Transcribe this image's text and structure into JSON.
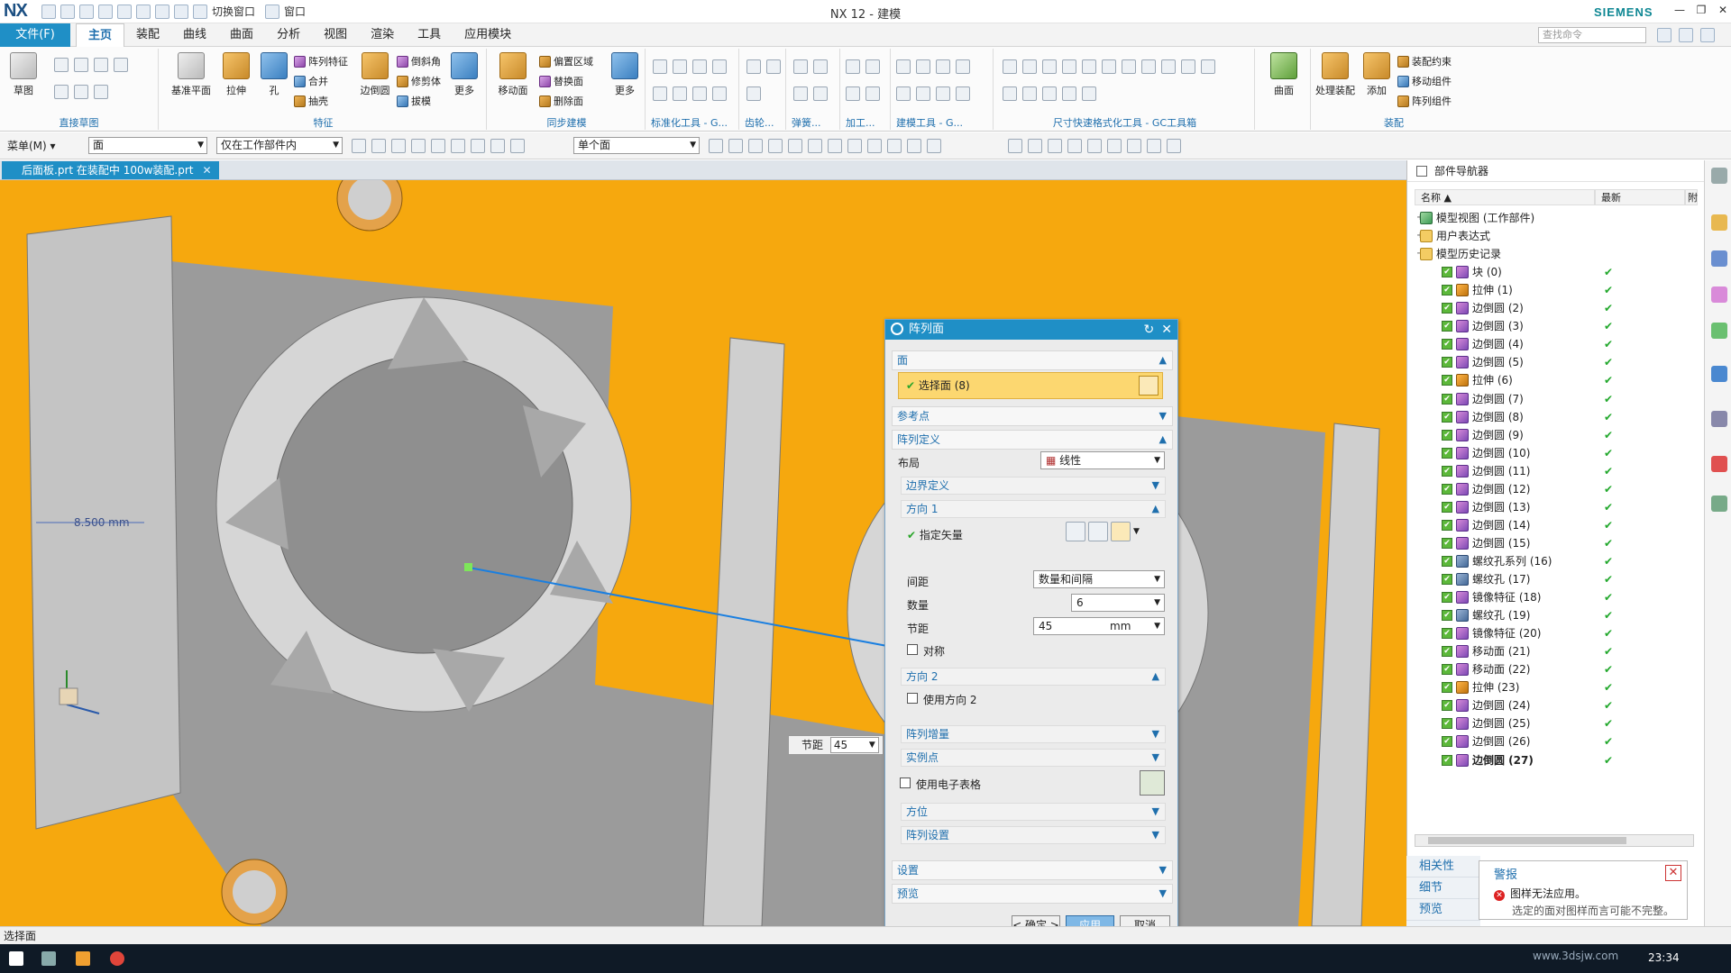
{
  "titlebar": {
    "logo": "NX",
    "title": "NX 12 - 建模",
    "brand": "SIEMENS",
    "switch_window": "切换窗口",
    "window": "窗口"
  },
  "menubar": {
    "file": "文件(F)",
    "tabs": [
      "主页",
      "装配",
      "曲线",
      "曲面",
      "分析",
      "视图",
      "渲染",
      "工具",
      "应用模块"
    ],
    "search_placeholder": "查找命令"
  },
  "ribbon": {
    "groups": {
      "direct_sketch": "直接草图",
      "feature": "特征",
      "sync": "同步建模",
      "std_tools": "标准化工具 - G...",
      "gear": "齿轮...",
      "spring": "弹簧...",
      "machining": "加工...",
      "build_tools": "建模工具 - G...",
      "dim_tools": "尺寸快速格式化工具 - GC工具箱",
      "assembly": "装配"
    },
    "buttons": {
      "sketch": "草图",
      "datum_plane": "基准平面",
      "extrude": "拉伸",
      "hole": "孔",
      "pattern_feature": "阵列特征",
      "unite": "合并",
      "shell": "抽壳",
      "edge_blend": "边倒圆",
      "chamfer": "倒斜角",
      "trim_body": "修剪体",
      "draft": "拔模",
      "more1": "更多",
      "move_face": "移动面",
      "offset_region": "偏置区域",
      "replace_face": "替换面",
      "delete_face": "删除面",
      "more2": "更多",
      "surface": "曲面",
      "process_assembly": "处理装配",
      "add": "添加",
      "assembly_constraint": "装配约束",
      "move_component": "移动组件",
      "pattern_component": "阵列组件"
    }
  },
  "toolbar2": {
    "menu": "菜单(M)",
    "filter": "面",
    "scope": "仅在工作部件内",
    "select_mode": "单个面"
  },
  "doctab": {
    "label": "后面板.prt 在装配中 100w装配.prt"
  },
  "viewport": {
    "dimension": "8.500 mm",
    "pitch_label": "节距",
    "pitch_value": "45"
  },
  "dialog": {
    "title": "阵列面",
    "face_section": "面",
    "select_face": "选择面 (8)",
    "ref_point": "参考点",
    "pattern_def": "阵列定义",
    "layout_label": "布局",
    "layout_value": "线性",
    "boundary": "边界定义",
    "dir1": "方向 1",
    "specify_vector": "指定矢量",
    "spacing_label": "间距",
    "spacing_value": "数量和间隔",
    "count_label": "数量",
    "count_value": "6",
    "pitch_label": "节距",
    "pitch_value": "45",
    "pitch_unit": "mm",
    "symmetric": "对称",
    "dir2": "方向 2",
    "use_dir2": "使用方向 2",
    "increment": "阵列增量",
    "instance_point": "实例点",
    "use_spreadsheet": "使用电子表格",
    "orientation": "方位",
    "pattern_settings": "阵列设置",
    "settings": "设置",
    "preview": "预览",
    "ok": "< 确定 >",
    "apply": "应用",
    "cancel": "取消"
  },
  "navigator": {
    "title": "部件导航器",
    "col_name": "名称",
    "col_latest": "最新",
    "col_extra": "附",
    "rows": [
      {
        "label": "模型视图 (工作部件)",
        "type": "model",
        "level": 0,
        "check": false
      },
      {
        "label": "用户表达式",
        "type": "folder",
        "level": 0,
        "check": false
      },
      {
        "label": "模型历史记录",
        "type": "folder",
        "level": 0,
        "check": false
      },
      {
        "label": "块 (0)",
        "type": "feat",
        "level": 1,
        "check": true
      },
      {
        "label": "拉伸 (1)",
        "type": "ext",
        "level": 1,
        "check": true
      },
      {
        "label": "边倒圆 (2)",
        "type": "feat",
        "level": 1,
        "check": true
      },
      {
        "label": "边倒圆 (3)",
        "type": "feat",
        "level": 1,
        "check": true
      },
      {
        "label": "边倒圆 (4)",
        "type": "feat",
        "level": 1,
        "check": true
      },
      {
        "label": "边倒圆 (5)",
        "type": "feat",
        "level": 1,
        "check": true
      },
      {
        "label": "拉伸 (6)",
        "type": "ext",
        "level": 1,
        "check": true
      },
      {
        "label": "边倒圆 (7)",
        "type": "feat",
        "level": 1,
        "check": true
      },
      {
        "label": "边倒圆 (8)",
        "type": "feat",
        "level": 1,
        "check": true
      },
      {
        "label": "边倒圆 (9)",
        "type": "feat",
        "level": 1,
        "check": true
      },
      {
        "label": "边倒圆 (10)",
        "type": "feat",
        "level": 1,
        "check": true
      },
      {
        "label": "边倒圆 (11)",
        "type": "feat",
        "level": 1,
        "check": true
      },
      {
        "label": "边倒圆 (12)",
        "type": "feat",
        "level": 1,
        "check": true
      },
      {
        "label": "边倒圆 (13)",
        "type": "feat",
        "level": 1,
        "check": true
      },
      {
        "label": "边倒圆 (14)",
        "type": "feat",
        "level": 1,
        "check": true
      },
      {
        "label": "边倒圆 (15)",
        "type": "feat",
        "level": 1,
        "check": true
      },
      {
        "label": "螺纹孔系列 (16)",
        "type": "hole",
        "level": 1,
        "check": true
      },
      {
        "label": "螺纹孔 (17)",
        "type": "hole",
        "level": 1,
        "check": true
      },
      {
        "label": "镜像特征 (18)",
        "type": "feat",
        "level": 1,
        "check": true
      },
      {
        "label": "螺纹孔 (19)",
        "type": "hole",
        "level": 1,
        "check": true
      },
      {
        "label": "镜像特征 (20)",
        "type": "feat",
        "level": 1,
        "check": true
      },
      {
        "label": "移动面 (21)",
        "type": "feat",
        "level": 1,
        "check": true
      },
      {
        "label": "移动面 (22)",
        "type": "feat",
        "level": 1,
        "check": true
      },
      {
        "label": "拉伸 (23)",
        "type": "ext",
        "level": 1,
        "check": true
      },
      {
        "label": "边倒圆 (24)",
        "type": "feat",
        "level": 1,
        "check": true
      },
      {
        "label": "边倒圆 (25)",
        "type": "feat",
        "level": 1,
        "check": true
      },
      {
        "label": "边倒圆 (26)",
        "type": "feat",
        "level": 1,
        "check": true
      },
      {
        "label": "边倒圆 (27)",
        "type": "feat",
        "level": 1,
        "check": true
      }
    ],
    "footer": [
      "相关性",
      "细节",
      "预览"
    ]
  },
  "alert": {
    "title": "警报",
    "line1": "图样无法应用。",
    "line2": "选定的面对图样而言可能不完整。"
  },
  "status": {
    "text": "选择面"
  },
  "taskbar": {
    "time": "23:34",
    "watermark": "www.3dsjw.com"
  },
  "colors": {
    "accent": "#1f8fc6",
    "viewport_bg": "#f6a80e",
    "model_gray": "#9a9a9a"
  }
}
